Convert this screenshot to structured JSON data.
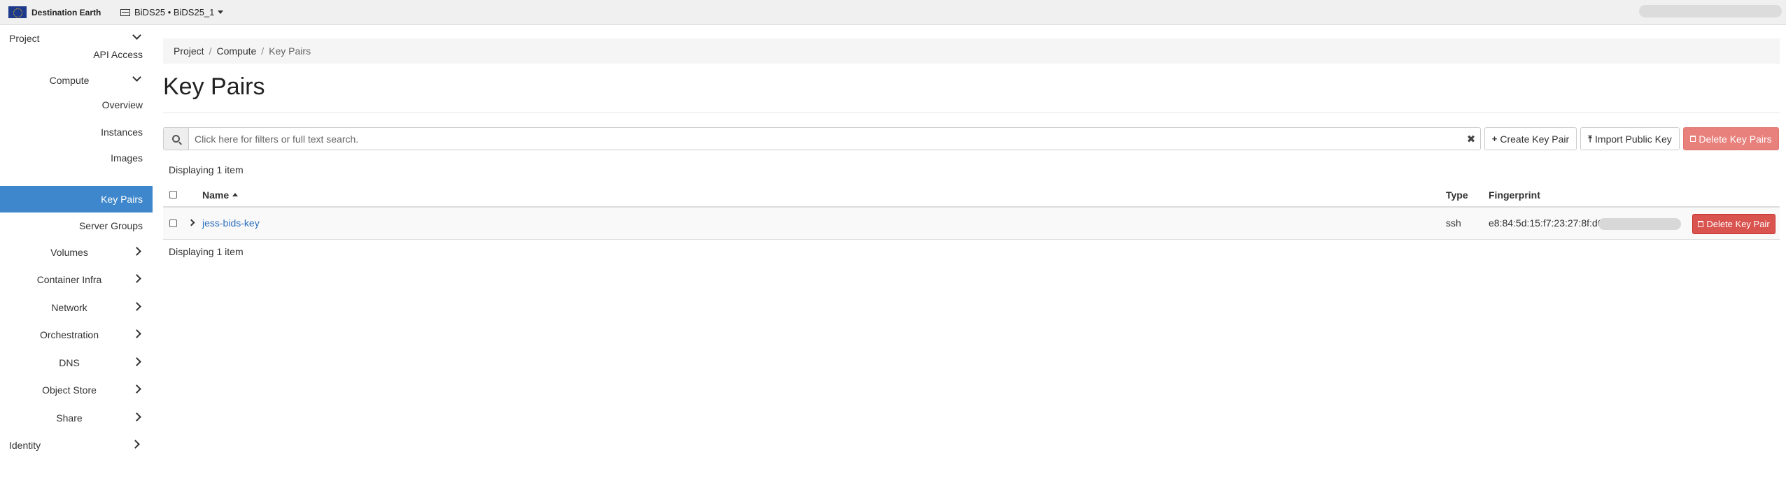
{
  "topbar": {
    "brand": "Destination Earth",
    "project": "BiDS25 • BiDS25_1"
  },
  "sidebar": {
    "project": "Project",
    "api_access": "API Access",
    "compute": "Compute",
    "overview": "Overview",
    "instances": "Instances",
    "images": "Images",
    "key_pairs": "Key Pairs",
    "server_groups": "Server Groups",
    "volumes": "Volumes",
    "container_infra": "Container Infra",
    "network": "Network",
    "orchestration": "Orchestration",
    "dns": "DNS",
    "object_store": "Object Store",
    "share": "Share",
    "identity": "Identity"
  },
  "breadcrumb": {
    "project": "Project",
    "compute": "Compute",
    "current": "Key Pairs",
    "separator": "/"
  },
  "page": {
    "title": "Key Pairs",
    "search_placeholder": "Click here for filters or full text search.",
    "clear_glyph": "✖",
    "create_btn": "Create Key Pair",
    "import_btn": "Import Public Key",
    "delete_btn": "Delete Key Pairs",
    "plus_glyph": "+",
    "upload_glyph": "⤒",
    "count_text": "Displaying 1 item"
  },
  "table": {
    "headers": {
      "name": "Name",
      "type": "Type",
      "fingerprint": "Fingerprint"
    },
    "rows": [
      {
        "name": "jess-bids-key",
        "type": "ssh",
        "fingerprint": "e8:84:5d:15:f7:23:27:8f:d6:97",
        "action": "Delete Key Pair"
      }
    ]
  },
  "colors": {
    "accent": "#3f87cc",
    "danger": "#d9534f",
    "danger_disabled": "#e8807c",
    "link": "#2a6ebb"
  }
}
